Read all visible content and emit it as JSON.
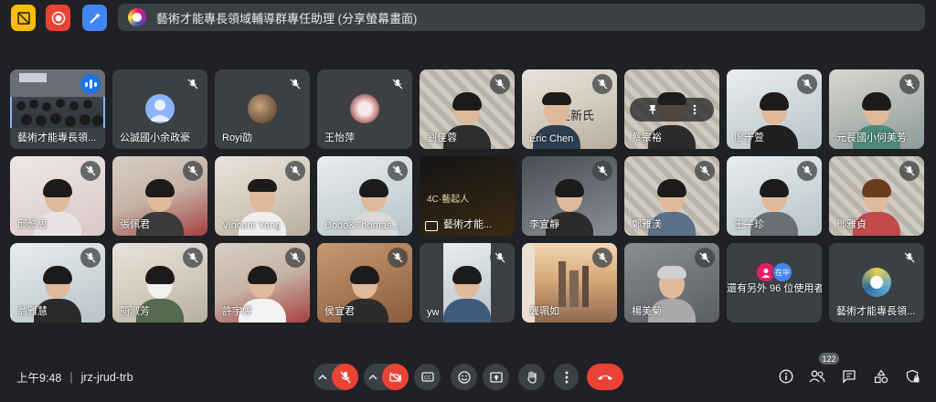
{
  "top_toolbar": {
    "icons": [
      "no-camera-grid-icon",
      "record-icon",
      "edit-wand-icon"
    ],
    "colors": {
      "yellow": "#fbbc04",
      "red": "#ea4335",
      "blue": "#4285f4"
    }
  },
  "banner": {
    "text": "藝術才能專長領域輔導群專任助理 (分享螢幕畫面)"
  },
  "participants": [
    {
      "name": "藝術才能專長領...",
      "state": "speaking",
      "icon": "audio-bars-icon"
    },
    {
      "name": "公誠國小余政豪",
      "state": "muted"
    },
    {
      "name": "Royi劭",
      "state": "muted"
    },
    {
      "name": "王怡萍",
      "state": "muted"
    },
    {
      "name": "劉佳蓉",
      "state": "muted"
    },
    {
      "name": "Eric Chen",
      "state": "muted",
      "overlay": "更新氏"
    },
    {
      "name": "蔡宗裕",
      "state": "muted"
    },
    {
      "name": "廖于萱",
      "state": "muted"
    },
    {
      "name": "元長國小何美芳",
      "state": "muted"
    },
    {
      "name": "邱懿思",
      "state": "muted"
    },
    {
      "name": "張佩君",
      "state": "muted"
    },
    {
      "name": "Vincent Yang",
      "state": "muted"
    },
    {
      "name": "Dodo&Thomas...",
      "state": "muted"
    },
    {
      "name": "藝術才能...",
      "state": "presenting",
      "poster": "4C·藝起人"
    },
    {
      "name": "李宜靜",
      "state": "muted"
    },
    {
      "name": "鄭雅渼",
      "state": "muted"
    },
    {
      "name": "王子珍",
      "state": "muted"
    },
    {
      "name": "鄧雅貞",
      "state": "muted"
    },
    {
      "name": "翁雅慧",
      "state": "muted"
    },
    {
      "name": "簡淑芳",
      "state": "muted"
    },
    {
      "name": "許宇婷",
      "state": "muted"
    },
    {
      "name": "侯宜君",
      "state": "muted"
    },
    {
      "name": "yw",
      "state": "muted"
    },
    {
      "name": "龔珮如",
      "state": "muted"
    },
    {
      "name": "楊美菊",
      "state": "muted"
    }
  ],
  "others_tile": {
    "mini_label": "在中",
    "text": "還有另外 96 位使用者"
  },
  "presenter_tile": {
    "name": "藝術才能專長領..."
  },
  "bottom": {
    "time": "上午9:48",
    "separator": "|",
    "meeting_code": "jrz-jrud-trb",
    "participant_count": "122"
  }
}
